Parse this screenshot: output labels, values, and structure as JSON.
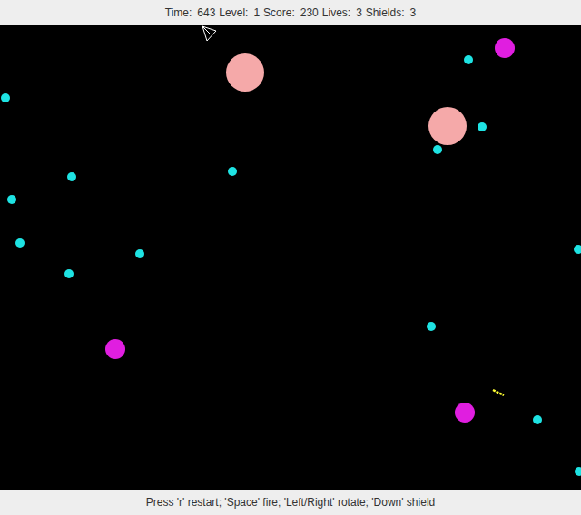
{
  "status": [
    {
      "label": "Time:",
      "value": "643"
    },
    {
      "label": "Level:",
      "value": "1"
    },
    {
      "label": "Score:",
      "value": "230"
    },
    {
      "label": "Lives:",
      "value": "3"
    },
    {
      "label": "Shields:",
      "value": "3"
    }
  ],
  "asteroids": [
    {
      "kind": "large",
      "color": "#f5a9a9"
    },
    {
      "kind": "large",
      "color": "#f5a9a9"
    },
    {
      "kind": "medium",
      "color": "#e01ee0"
    },
    {
      "kind": "medium",
      "color": "#e01ee0"
    },
    {
      "kind": "medium",
      "color": "#e01ee0"
    },
    {
      "kind": "small",
      "color": "#1ee3e3"
    },
    {
      "kind": "small",
      "color": "#1ee3e3"
    },
    {
      "kind": "small",
      "color": "#1ee3e3"
    },
    {
      "kind": "small",
      "color": "#1ee3e3"
    },
    {
      "kind": "small",
      "color": "#1ee3e3"
    },
    {
      "kind": "small",
      "color": "#1ee3e3"
    },
    {
      "kind": "small",
      "color": "#1ee3e3"
    },
    {
      "kind": "small",
      "color": "#1ee3e3"
    },
    {
      "kind": "small",
      "color": "#1ee3e3"
    },
    {
      "kind": "small",
      "color": "#1ee3e3"
    },
    {
      "kind": "small",
      "color": "#1ee3e3"
    },
    {
      "kind": "small",
      "color": "#1ee3e3"
    },
    {
      "kind": "small",
      "color": "#1ee3e3"
    },
    {
      "kind": "small",
      "color": "#1ee3e3"
    }
  ],
  "bullets": [
    {
      "color": "#ffff33"
    }
  ],
  "help": "Press 'r' restart; 'Space' fire; 'Left/Right' rotate; 'Down' shield"
}
